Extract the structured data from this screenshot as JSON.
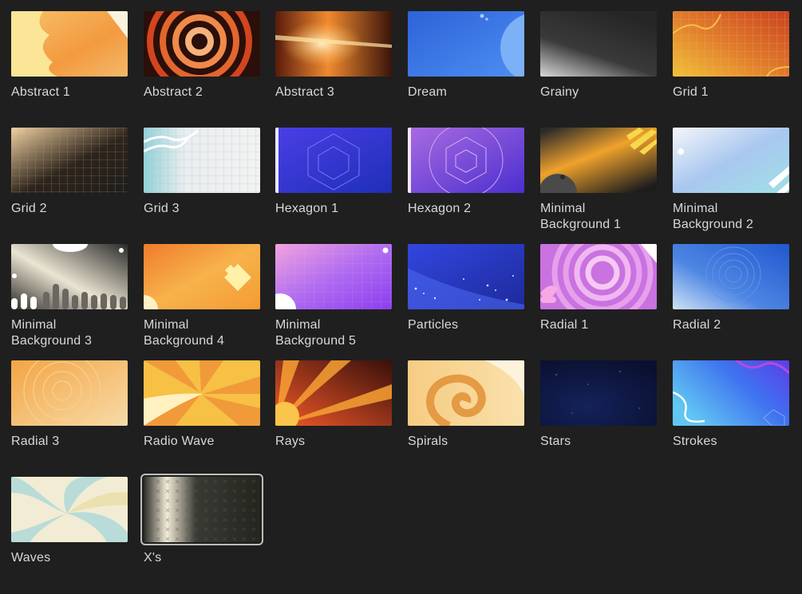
{
  "backgrounds": [
    {
      "label": "Abstract 1",
      "icon": "abstract-1-thumbnail",
      "selected": false
    },
    {
      "label": "Abstract 2",
      "icon": "abstract-2-thumbnail",
      "selected": false
    },
    {
      "label": "Abstract 3",
      "icon": "abstract-3-thumbnail",
      "selected": false
    },
    {
      "label": "Dream",
      "icon": "dream-thumbnail",
      "selected": false
    },
    {
      "label": "Grainy",
      "icon": "grainy-thumbnail",
      "selected": false
    },
    {
      "label": "Grid 1",
      "icon": "grid-1-thumbnail",
      "selected": false
    },
    {
      "label": "Grid 2",
      "icon": "grid-2-thumbnail",
      "selected": false
    },
    {
      "label": "Grid 3",
      "icon": "grid-3-thumbnail",
      "selected": false
    },
    {
      "label": "Hexagon 1",
      "icon": "hexagon-1-thumbnail",
      "selected": false
    },
    {
      "label": "Hexagon 2",
      "icon": "hexagon-2-thumbnail",
      "selected": false
    },
    {
      "label": "Minimal\nBackground 1",
      "icon": "minimal-background-1-thumbnail",
      "selected": false
    },
    {
      "label": "Minimal\nBackground 2",
      "icon": "minimal-background-2-thumbnail",
      "selected": false
    },
    {
      "label": "Minimal\nBackground 3",
      "icon": "minimal-background-3-thumbnail",
      "selected": false
    },
    {
      "label": "Minimal\nBackground 4",
      "icon": "minimal-background-4-thumbnail",
      "selected": false
    },
    {
      "label": "Minimal\nBackground 5",
      "icon": "minimal-background-5-thumbnail",
      "selected": false
    },
    {
      "label": "Particles",
      "icon": "particles-thumbnail",
      "selected": false
    },
    {
      "label": "Radial 1",
      "icon": "radial-1-thumbnail",
      "selected": false
    },
    {
      "label": "Radial 2",
      "icon": "radial-2-thumbnail",
      "selected": false
    },
    {
      "label": "Radial 3",
      "icon": "radial-3-thumbnail",
      "selected": false
    },
    {
      "label": "Radio Wave",
      "icon": "radio-wave-thumbnail",
      "selected": false
    },
    {
      "label": "Rays",
      "icon": "rays-thumbnail",
      "selected": false
    },
    {
      "label": "Spirals",
      "icon": "spirals-thumbnail",
      "selected": false
    },
    {
      "label": "Stars",
      "icon": "stars-thumbnail",
      "selected": false
    },
    {
      "label": "Strokes",
      "icon": "strokes-thumbnail",
      "selected": false
    },
    {
      "label": "Waves",
      "icon": "waves-thumbnail",
      "selected": false
    },
    {
      "label": "X's",
      "icon": "xs-thumbnail",
      "selected": true
    }
  ],
  "colors": {
    "background": "#1f1f1f",
    "label": "#d8d8d8",
    "selection_outline": "#bdbdbd"
  }
}
